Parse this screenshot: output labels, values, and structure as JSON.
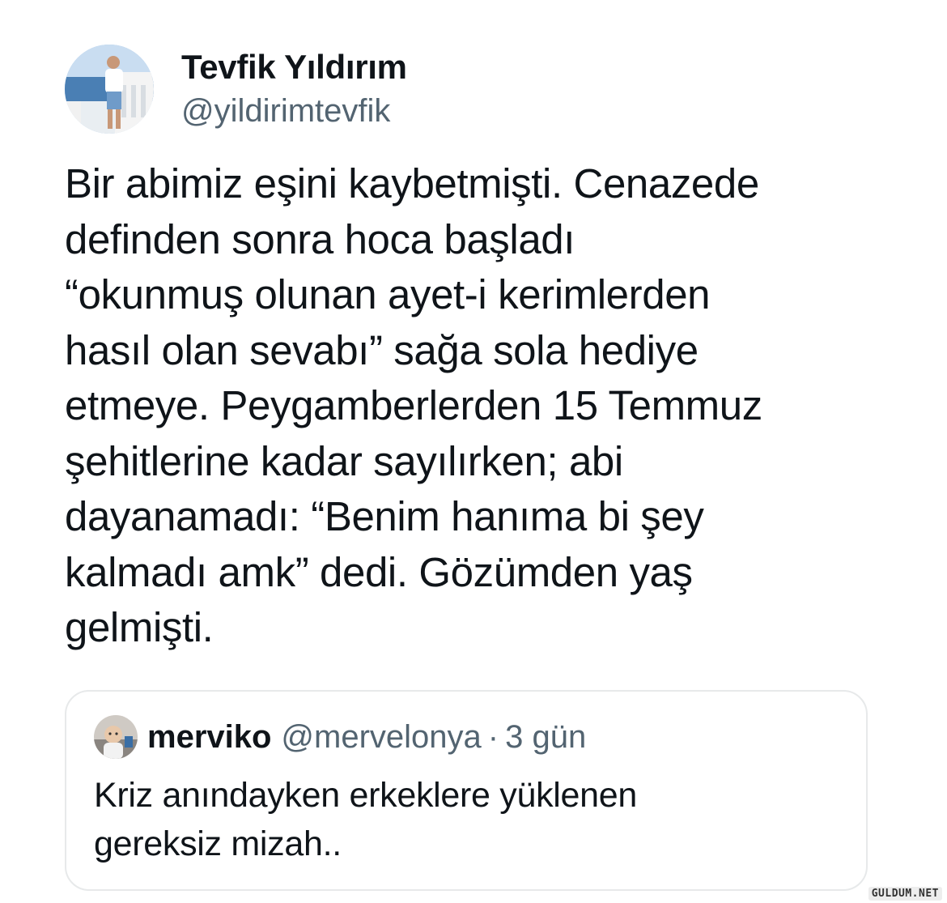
{
  "author": {
    "display_name": "Tevfik Yıldırım",
    "handle": "@yildirimtevfik",
    "avatar_icon": "profile-photo"
  },
  "tweet": {
    "text": "Bir abimiz eşini kaybetmişti. Cenazede\ndefinden sonra hoca başladı\n“okunmuş olunan ayet-i kerimlerden\nhasıl olan sevabı” sağa sola hediye\netmeye. Peygamberlerden 15 Temmuz\nşehitlerine kadar sayılırken; abi\ndayanamadı: “Benim hanıma bi şey\nkalmadı amk” dedi. Gözümden yaş\ngelmişti."
  },
  "quoted": {
    "display_name": "merviko",
    "handle": "@mervelonya",
    "separator": "·",
    "time": "3 gün",
    "text": "Kriz anındayken erkeklere yüklenen\ngereksiz mizah..",
    "avatar_icon": "profile-photo"
  },
  "watermark": "GULDUM.NET",
  "colors": {
    "text": "#0f1419",
    "secondary": "#536471",
    "border": "#e7e9ea",
    "background": "#ffffff"
  }
}
